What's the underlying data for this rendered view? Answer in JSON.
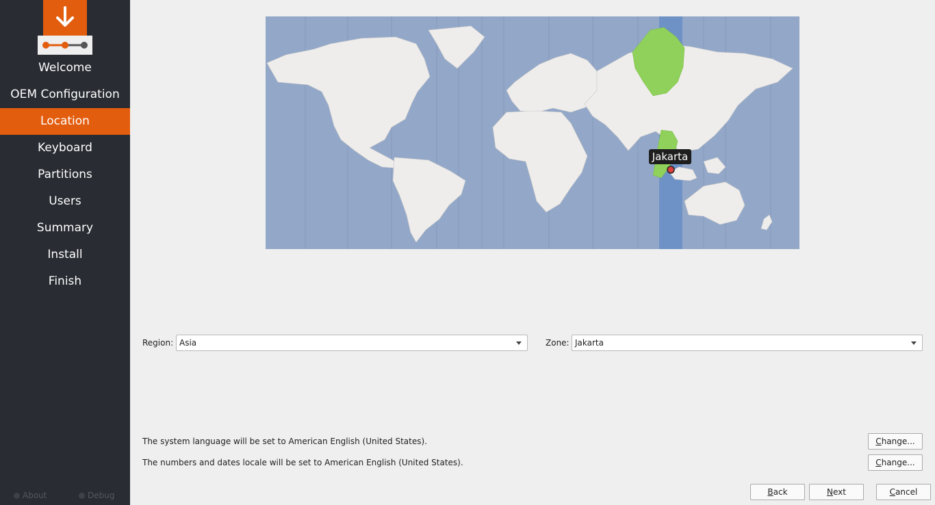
{
  "sidebar": {
    "steps": [
      {
        "label": "Welcome"
      },
      {
        "label": "OEM Configuration"
      },
      {
        "label": "Location"
      },
      {
        "label": "Keyboard"
      },
      {
        "label": "Partitions"
      },
      {
        "label": "Users"
      },
      {
        "label": "Summary"
      },
      {
        "label": "Install"
      },
      {
        "label": "Finish"
      }
    ],
    "active_step": "Location",
    "footer": {
      "about": "About",
      "debug": "Debug"
    }
  },
  "map": {
    "selected_city": "Jakarta"
  },
  "region": {
    "label": "Region:",
    "value": "Asia"
  },
  "zone": {
    "label": "Zone:",
    "value": "Jakarta"
  },
  "locale": {
    "language_text": "The system language will be set to American English (United States).",
    "numbers_text": "The numbers and dates locale will be set to American English (United States).",
    "change_first": "C",
    "change_rest": "hange..."
  },
  "buttons": {
    "back_first": "B",
    "back_rest": "ack",
    "next_first": "N",
    "next_rest": "ext",
    "cancel_first": "C",
    "cancel_rest": "ancel"
  },
  "colors": {
    "accent": "#e35d0f",
    "sidebar_bg": "#292c33",
    "map_water": "#93a8c8",
    "timezone_band": "#6e92c6",
    "zone_highlight": "#8fd15a"
  }
}
